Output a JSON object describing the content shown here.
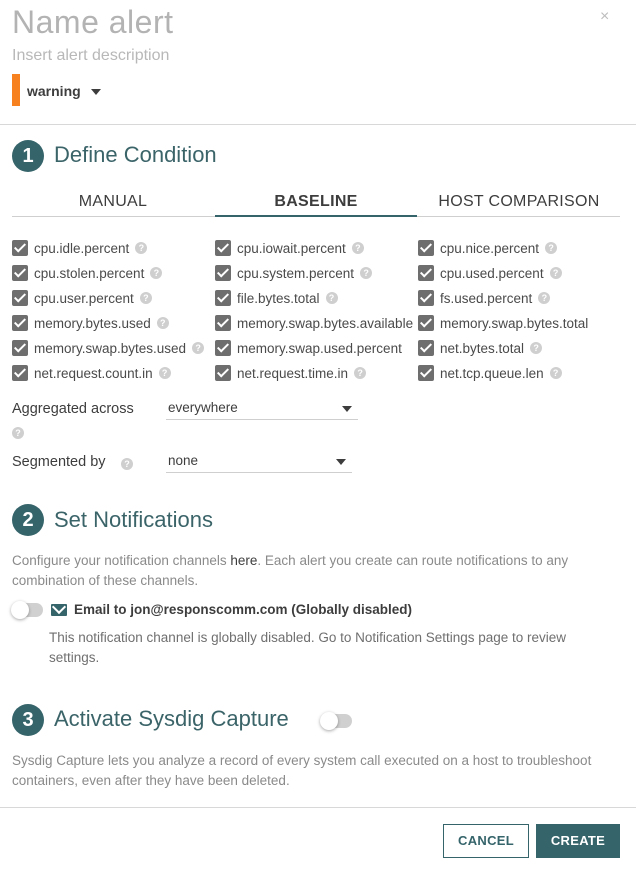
{
  "header": {
    "title_placeholder": "Name alert",
    "description_placeholder": "Insert alert description",
    "severity": "warning",
    "colors": {
      "severity_bar": "#f7811f",
      "accent": "#35646a"
    }
  },
  "condition": {
    "step_number": "1",
    "title": "Define Condition",
    "tabs": [
      {
        "label": "MANUAL",
        "active": false
      },
      {
        "label": "BASELINE",
        "active": true
      },
      {
        "label": "HOST COMPARISON",
        "active": false
      }
    ],
    "metrics": [
      {
        "label": "cpu.idle.percent",
        "checked": true
      },
      {
        "label": "cpu.iowait.percent",
        "checked": true
      },
      {
        "label": "cpu.nice.percent",
        "checked": true
      },
      {
        "label": "cpu.stolen.percent",
        "checked": true
      },
      {
        "label": "cpu.system.percent",
        "checked": true
      },
      {
        "label": "cpu.used.percent",
        "checked": true
      },
      {
        "label": "cpu.user.percent",
        "checked": true
      },
      {
        "label": "file.bytes.total",
        "checked": true
      },
      {
        "label": "fs.used.percent",
        "checked": true
      },
      {
        "label": "memory.bytes.used",
        "checked": true
      },
      {
        "label": "memory.swap.bytes.available",
        "checked": true
      },
      {
        "label": "memory.swap.bytes.total",
        "checked": true
      },
      {
        "label": "memory.swap.bytes.used",
        "checked": true
      },
      {
        "label": "memory.swap.used.percent",
        "checked": true
      },
      {
        "label": "net.bytes.total",
        "checked": true
      },
      {
        "label": "net.request.count.in",
        "checked": true
      },
      {
        "label": "net.request.time.in",
        "checked": true
      },
      {
        "label": "net.tcp.queue.len",
        "checked": true
      }
    ],
    "aggregated_label": "Aggregated across",
    "aggregated_value": "everywhere",
    "segmented_label": "Segmented by",
    "segmented_value": "none"
  },
  "notifications": {
    "step_number": "2",
    "title": "Set Notifications",
    "intro_part1": "Configure your notification channels ",
    "intro_link": "here",
    "intro_part2": ". Each alert you create can route notifications to any",
    "intro_line2": "combination of these channels.",
    "channel_label": "Email to jon@responscomm.com (Globally disabled)",
    "channel_enabled": false,
    "disabled_line1": "This notification channel is globally disabled. Go to Notification Settings page to review",
    "disabled_line2": "settings."
  },
  "capture": {
    "step_number": "3",
    "title": "Activate Sysdig Capture",
    "enabled": false,
    "desc_line1": "Sysdig Capture lets you analyze a record of every system call executed on a host to troubleshoot",
    "desc_line2": "containers, even after they have been deleted."
  },
  "footer": {
    "cancel_label": "CANCEL",
    "create_label": "CREATE"
  },
  "icons": {
    "close": "×",
    "help": "?"
  }
}
